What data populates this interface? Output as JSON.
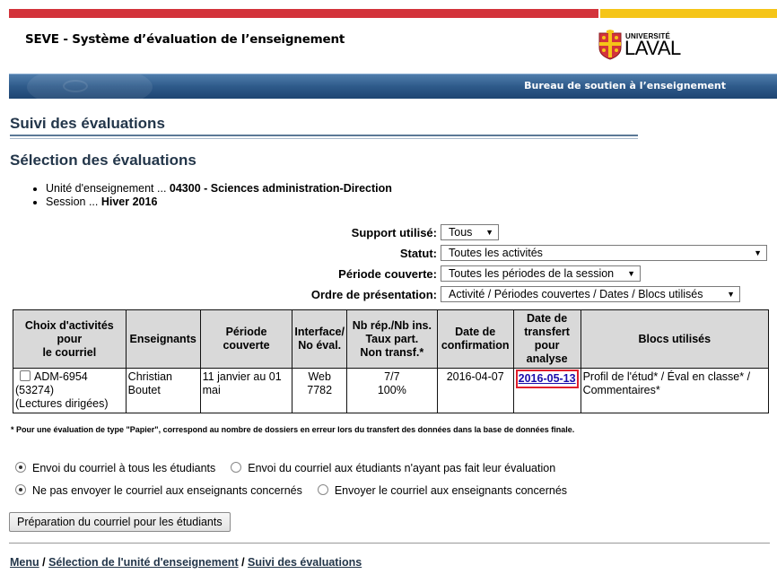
{
  "header": {
    "app_title": "SEVE - Système d’évaluation de l’enseignement",
    "logo_small": "UNIVERSITÉ",
    "logo_big": "LAVAL",
    "banner_text": "Bureau de soutien à l’enseignement"
  },
  "page": {
    "title": "Suivi des évaluations",
    "subtitle": "Sélection des évaluations"
  },
  "info": {
    "unit_label": "Unité d'enseignement ... ",
    "unit_value": "04300 - Sciences administration-Direction",
    "session_label": "Session ... ",
    "session_value": "Hiver 2016"
  },
  "filters": {
    "support_label": "Support utilisé:",
    "support_value": "Tous",
    "statut_label": "Statut:",
    "statut_value": "Toutes les activités",
    "periode_label": "Période couverte:",
    "periode_value": "Toutes les périodes de la session",
    "ordre_label": "Ordre de présentation:",
    "ordre_value": "Activité / Périodes couvertes / Dates / Blocs utilisés"
  },
  "table": {
    "headers": {
      "choix_l1": "Choix d'activités",
      "choix_l2": "pour",
      "choix_l3": "le courriel",
      "enseignants": "Enseignants",
      "periode_l1": "Période",
      "periode_l2": "couverte",
      "interface_l1": "Interface/",
      "interface_l2": "No éval.",
      "nbrep_l1": "Nb rép./Nb ins.",
      "nbrep_l2": "Taux part.",
      "nbrep_l3": "Non transf.*",
      "confirm_l1": "Date de",
      "confirm_l2": "confirmation",
      "transfert_l1": "Date de",
      "transfert_l2": "transfert",
      "transfert_l3": "pour",
      "transfert_l4": "analyse",
      "blocs": "Blocs utilisés"
    },
    "row": {
      "activity_code": "ADM-6954",
      "activity_id": "(53274)",
      "activity_type": "(Lectures dirigées)",
      "teacher_l1": "Christian",
      "teacher_l2": "Boutet",
      "periode_l1": "11 janvier au 01",
      "periode_l2": "mai",
      "interface_l1": "Web",
      "interface_l2": "7782",
      "nbrep_l1": "7/7",
      "nbrep_l2": "100%",
      "date_confirmation": "2016-04-07",
      "date_transfert": "2016-05-13",
      "blocs_l1": "Profil de l'étud* / Éval en classe* /",
      "blocs_l2": "Commentaires*"
    }
  },
  "footnote": "* Pour une évaluation de type \"Papier\", correspond au nombre de dossiers en erreur lors du transfert des données dans la base de données finale.",
  "options": {
    "envoi_tous": "Envoi du courriel à tous les étudiants",
    "envoi_non_fait": "Envoi du courriel aux étudiants n'ayant pas fait leur évaluation",
    "ne_pas_envoyer": "Ne pas envoyer le courriel aux enseignants concernés",
    "envoyer_ens": "Envoyer le courriel aux enseignants concernés"
  },
  "prep_button": "Préparation du courriel pour les étudiants",
  "breadcrumb": {
    "menu": "Menu",
    "sep": " / ",
    "unite": "Sélection de l'unité d'enseignement",
    "suivi": "Suivi des évaluations"
  },
  "colors": {
    "red_bar": "#d3333b",
    "yellow_bar": "#f5c518",
    "banner_blue": "#2e5a8a",
    "heading": "#23364a",
    "highlight": "#e0202c"
  },
  "icons": {
    "logo": "universite-laval-shield-icon",
    "dropdown": "dropdown-arrow-icon"
  }
}
